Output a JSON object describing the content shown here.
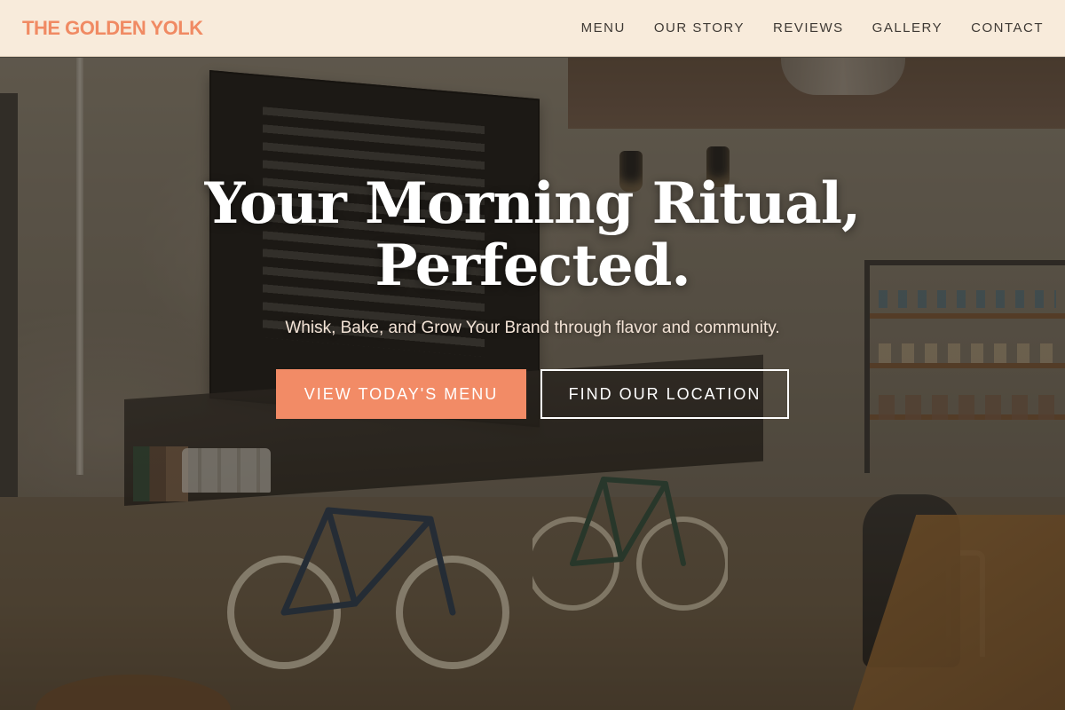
{
  "header": {
    "brand": "THE GOLDEN YOLK",
    "nav": [
      {
        "label": "MENU"
      },
      {
        "label": "OUR STORY"
      },
      {
        "label": "REVIEWS"
      },
      {
        "label": "GALLERY"
      },
      {
        "label": "CONTACT"
      }
    ]
  },
  "hero": {
    "title_line1": "Your Morning Ritual,",
    "title_line2": "Perfected.",
    "subtitle": "Whisk, Bake, and Grow Your Brand through flavor and community.",
    "primary_button": "VIEW TODAY'S MENU",
    "secondary_button": "FIND OUR LOCATION"
  },
  "colors": {
    "accent": "#f28b66",
    "brand": "#f08a63",
    "header_bg": "#f8ebdb",
    "text_dark": "#3f3a35"
  }
}
